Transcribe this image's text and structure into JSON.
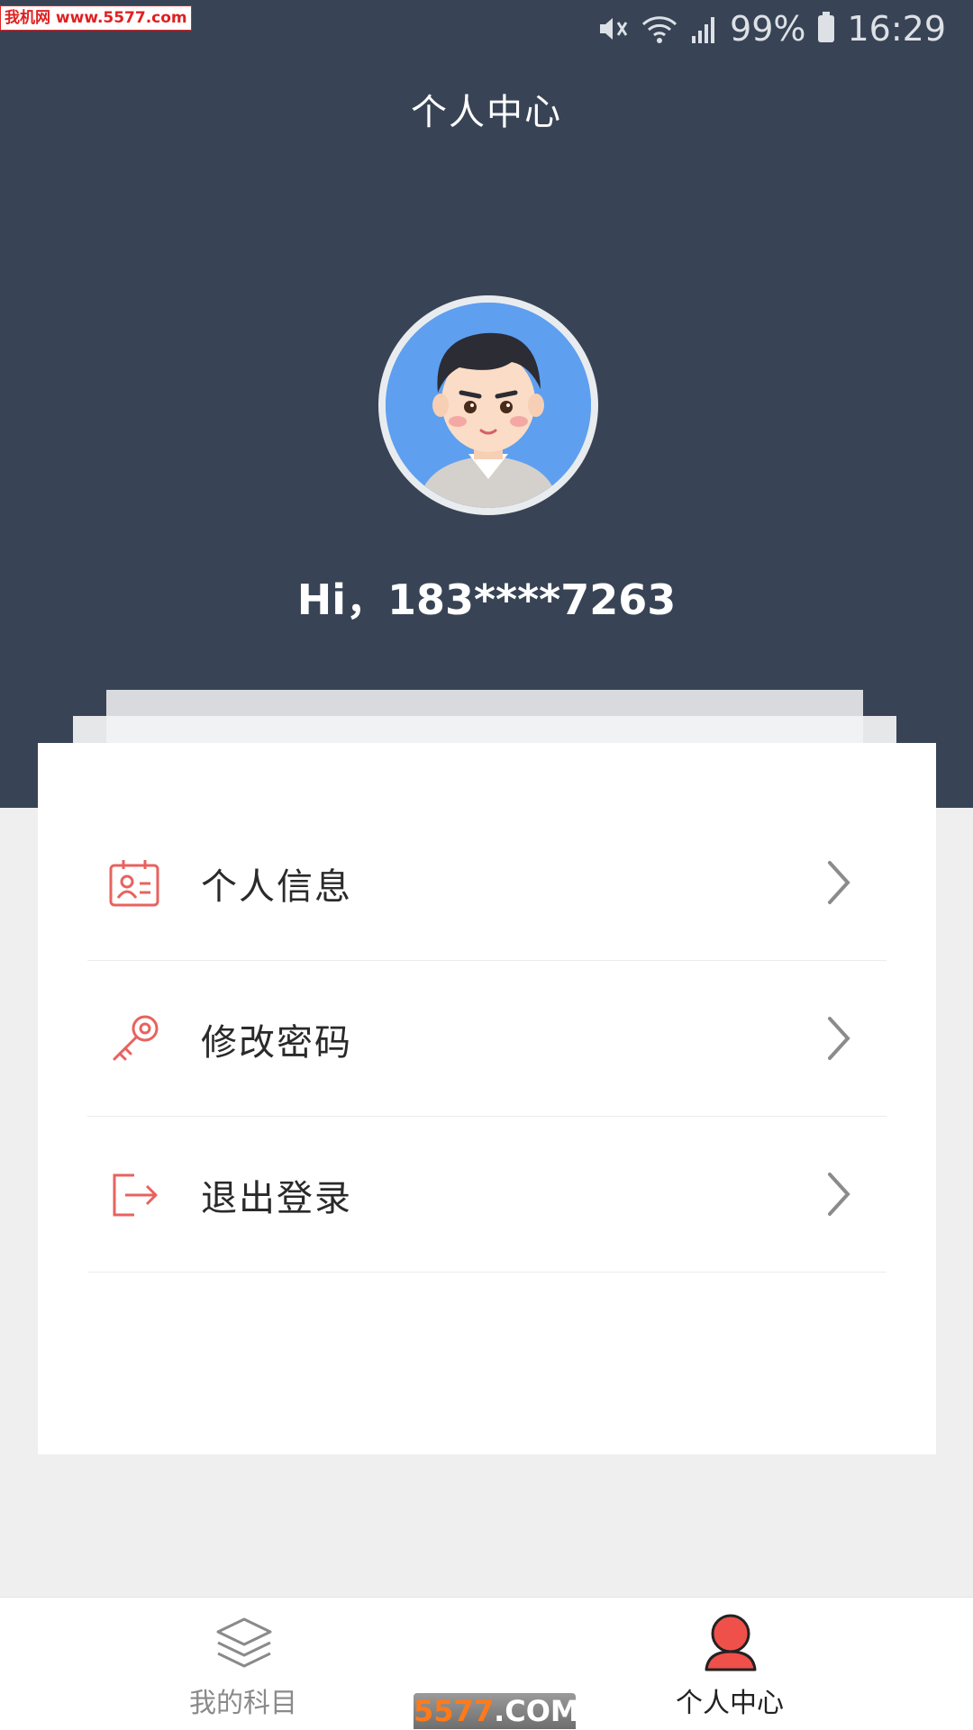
{
  "status_bar": {
    "watermark": "我机网 www.5577.com",
    "battery": "99%",
    "time": "16:29"
  },
  "header": {
    "title": "个人中心",
    "greeting": "Hi，183****7263"
  },
  "menu": {
    "items": [
      {
        "label": "个人信息",
        "icon": "id-card-icon"
      },
      {
        "label": "修改密码",
        "icon": "key-icon"
      },
      {
        "label": "退出登录",
        "icon": "logout-icon"
      }
    ]
  },
  "bottom_nav": {
    "tabs": [
      {
        "label": "我的科目",
        "icon": "layers-icon",
        "active": false
      },
      {
        "label": "个人中心",
        "icon": "user-icon",
        "active": true
      }
    ]
  },
  "footer_watermark": {
    "num": "5577",
    "dom": ".COM"
  },
  "colors": {
    "header_bg": "#384455",
    "accent": "#e8625f",
    "page_bg": "#efeff0"
  }
}
